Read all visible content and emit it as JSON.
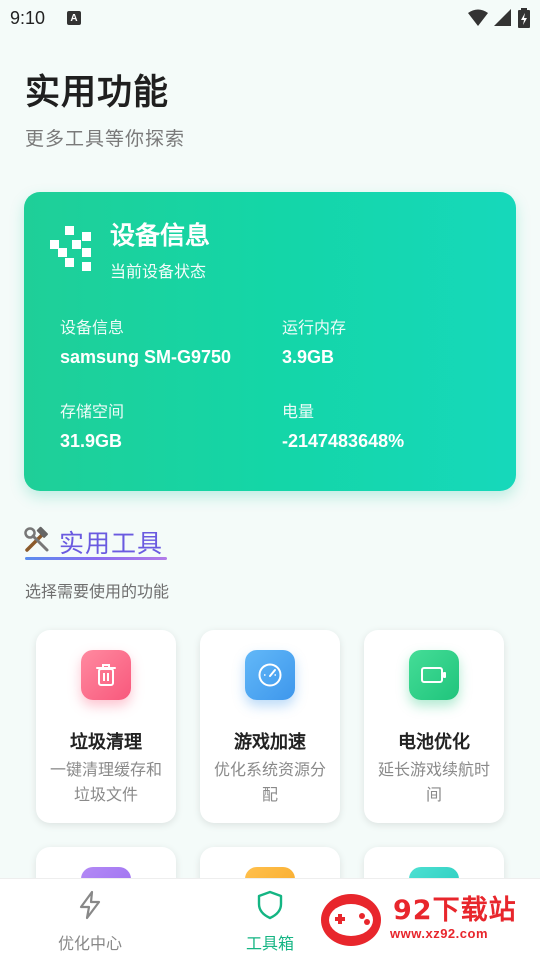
{
  "status_bar": {
    "time": "9:10",
    "badge": "A"
  },
  "header": {
    "title": "实用功能",
    "subtitle": "更多工具等你探索"
  },
  "device_card": {
    "title": "设备信息",
    "subtitle": "当前设备状态",
    "icon": "pixel-grid-icon",
    "items": [
      {
        "label": "设备信息",
        "value": "samsung SM-G9750"
      },
      {
        "label": "运行内存",
        "value": "3.9GB"
      },
      {
        "label": "存储空间",
        "value": "31.9GB"
      },
      {
        "label": "电量",
        "value": "-2147483648%"
      }
    ]
  },
  "tools_section": {
    "icon": "hammer-wrench-icon",
    "title": "实用工具",
    "subtitle": "选择需要使用的功能"
  },
  "tools": [
    {
      "name": "垃圾清理",
      "desc": "一键清理缓存和垃圾文件",
      "icon": "trash-icon",
      "color": "#fb6d8a"
    },
    {
      "name": "游戏加速",
      "desc": "优化系统资源分配",
      "icon": "speedometer-icon",
      "color": "#4fa8f2"
    },
    {
      "name": "电池优化",
      "desc": "延长游戏续航时间",
      "icon": "battery-icon",
      "color": "#2fd18a"
    }
  ],
  "bottom_nav": [
    {
      "label": "优化中心",
      "icon": "lightning-icon",
      "active": false
    },
    {
      "label": "工具箱",
      "icon": "shield-icon",
      "active": true
    }
  ],
  "watermark": {
    "text": "92下载站",
    "url": "www.xz92.com"
  },
  "colors": {
    "accent_green": "#14c28e",
    "card_gradient_start": "#1fcf98",
    "card_gradient_end": "#16d8bb",
    "section_purple": "#6a5ae0"
  }
}
